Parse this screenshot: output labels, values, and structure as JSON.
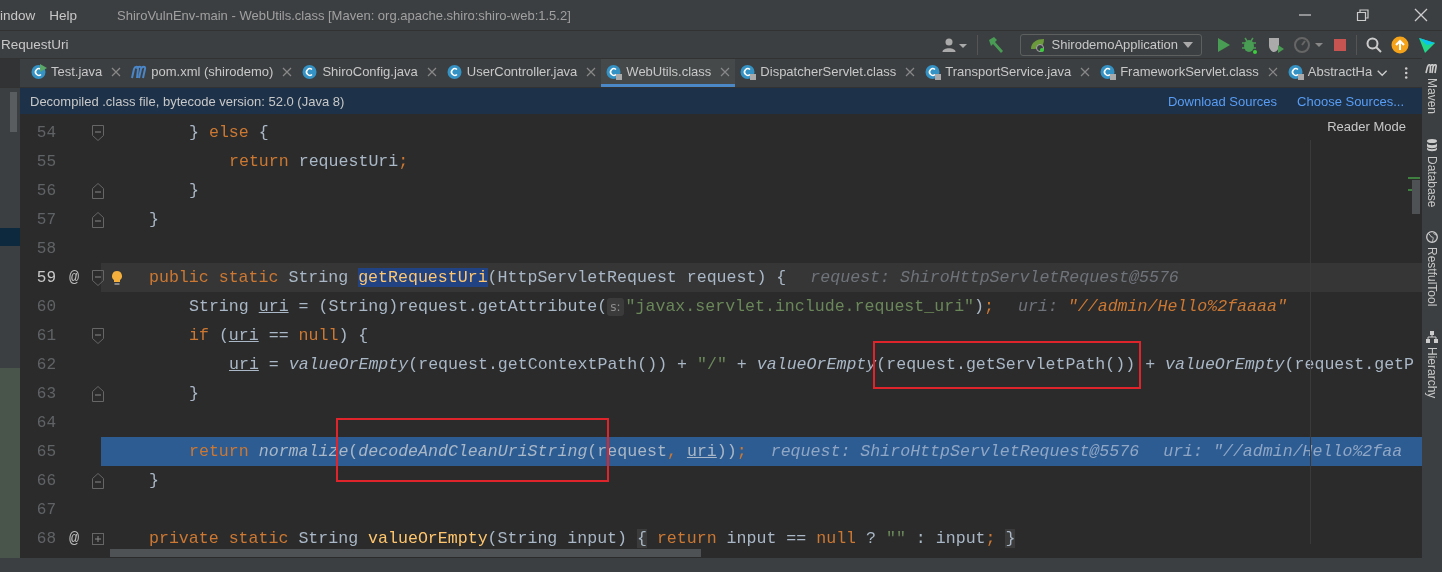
{
  "menu": [
    "indow",
    "Help"
  ],
  "window": {
    "title": "ShiroVulnEnv-main - WebUtils.class [Maven: org.apache.shiro:shiro-web:1.5.2]"
  },
  "breadcrumb": "RequestUri",
  "run_config": "ShirodemoApplication",
  "tabs": [
    {
      "label": "Test.java",
      "kind": "class-run",
      "selected": false,
      "closable": true
    },
    {
      "label": "pom.xml (shirodemo)",
      "kind": "maven",
      "selected": false,
      "closable": true
    },
    {
      "label": "ShiroConfig.java",
      "kind": "class",
      "selected": false,
      "closable": true
    },
    {
      "label": "UserController.java",
      "kind": "class",
      "selected": false,
      "closable": true
    },
    {
      "label": "WebUtils.class",
      "kind": "class-locked",
      "selected": true,
      "closable": true
    },
    {
      "label": "DispatcherServlet.class",
      "kind": "class-locked",
      "selected": false,
      "closable": true
    },
    {
      "label": "TransportService.java",
      "kind": "class-locked",
      "selected": false,
      "closable": true
    },
    {
      "label": "FrameworkServlet.class",
      "kind": "class-locked",
      "selected": false,
      "closable": true
    },
    {
      "label": "AbstractHa",
      "kind": "class-locked",
      "selected": false,
      "closable": false
    }
  ],
  "notice": {
    "text": "Decompiled .class file, bytecode version: 52.0 (Java 8)",
    "links": [
      "Download Sources",
      "Choose Sources..."
    ]
  },
  "reader_mode": "Reader Mode",
  "lines": [
    {
      "children": [
        {
          "number": "54",
          "current": false,
          "caret": false,
          "bulb": false,
          "fold_start": true,
          "fold_end": false,
          "collapsed": false,
          "tokens": [
            {
              "text": "} ",
              "kind": "plain"
            },
            {
              "text": "else",
              "kind": "kw"
            },
            {
              "text": " {",
              "kind": "plain"
            }
          ],
          "children": [
            {
              "number": "55",
              "current": false,
              "caret": false,
              "bulb": false,
              "fold_start": false,
              "fold_end": false,
              "collapsed": false,
              "tokens": [
                {
                  "text": "return",
                  "kind": "kw"
                },
                {
                  "text": " requestUri",
                  "kind": "plain"
                },
                {
                  "text": ";",
                  "kind": "kw"
                }
              ]
            }
          ]
        },
        {
          "number": "56",
          "current": false,
          "caret": false,
          "bulb": false,
          "fold_start": false,
          "fold_end": true,
          "collapsed": false,
          "tokens": [
            {
              "text": "}",
              "kind": "plain"
            }
          ]
        }
      ]
    },
    {
      "number": "57",
      "current": false,
      "caret": false,
      "bulb": false,
      "fold_start": false,
      "fold_end": true,
      "collapsed": false,
      "tokens": [
        {
          "text": "}",
          "kind": "plain"
        }
      ]
    },
    {
      "number": "58",
      "current": false,
      "caret": false,
      "bulb": false,
      "fold_start": false,
      "fold_end": false,
      "collapsed": false
    },
    {
      "number": "59",
      "mark": "@",
      "current": false,
      "caret": true,
      "bulb": true,
      "fold_start": true,
      "fold_end": false,
      "collapsed": false,
      "tokens": [
        {
          "text": "public static ",
          "kind": "kw"
        },
        {
          "text": "String ",
          "kind": "plain"
        },
        {
          "text": "getRequestUri",
          "kind": "decl-selected"
        },
        {
          "text": "(HttpServletRequest request) {",
          "kind": "plain"
        }
      ],
      "hints": [
        {
          "label": "request:",
          "value": "ShiroHttpServletRequest@5576",
          "kind": "object"
        }
      ],
      "children": [
        {
          "number": "60",
          "current": false,
          "caret": false,
          "bulb": false,
          "fold_start": false,
          "fold_end": false,
          "collapsed": false,
          "tokens": [
            {
              "text": "String ",
              "kind": "plain"
            },
            {
              "text": "uri",
              "kind": "var"
            },
            {
              "text": " = (String)request.getAttribute(",
              "kind": "plain"
            },
            {
              "text": "s:",
              "kind": "param-hint"
            },
            {
              "text": "\"javax.servlet.include.request_uri\"",
              "kind": "str"
            },
            {
              "text": ")",
              "kind": "plain"
            },
            {
              "text": ";",
              "kind": "kw"
            }
          ],
          "hints": [
            {
              "label": "uri:",
              "value": "\"//admin/Hello%2faaaa\"",
              "kind": "string"
            }
          ]
        },
        {
          "number": "61",
          "current": false,
          "caret": false,
          "bulb": false,
          "fold_start": true,
          "fold_end": false,
          "collapsed": false,
          "tokens": [
            {
              "text": "if",
              "kind": "kw"
            },
            {
              "text": " (",
              "kind": "plain"
            },
            {
              "text": "uri",
              "kind": "var"
            },
            {
              "text": " == ",
              "kind": "plain"
            },
            {
              "text": "null",
              "kind": "kw"
            },
            {
              "text": ") {",
              "kind": "plain"
            }
          ],
          "children": [
            {
              "number": "62",
              "current": false,
              "caret": false,
              "bulb": false,
              "fold_start": false,
              "fold_end": false,
              "collapsed": false,
              "tokens": [
                {
                  "text": "uri",
                  "kind": "var"
                },
                {
                  "text": " = ",
                  "kind": "plain"
                },
                {
                  "text": "valueOrEmpty",
                  "kind": "static"
                },
                {
                  "text": "(request.getContextPath()) + ",
                  "kind": "plain"
                },
                {
                  "text": "\"/\"",
                  "kind": "str"
                },
                {
                  "text": " + ",
                  "kind": "plain"
                },
                {
                  "text": "valueOrEmpty",
                  "kind": "static"
                },
                {
                  "text": "(request.getServletPath())",
                  "kind": "plain"
                },
                {
                  "text": " + ",
                  "kind": "plain"
                },
                {
                  "text": "valueOrEmpty",
                  "kind": "static"
                },
                {
                  "text": "(request.getP",
                  "kind": "plain"
                }
              ]
            }
          ]
        },
        {
          "number": "63",
          "current": false,
          "caret": false,
          "bulb": false,
          "fold_start": false,
          "fold_end": true,
          "collapsed": false,
          "tokens": [
            {
              "text": "}",
              "kind": "plain"
            }
          ]
        },
        {
          "number": "64",
          "current": false,
          "caret": false,
          "bulb": false,
          "fold_start": false,
          "fold_end": false,
          "collapsed": false
        },
        {
          "number": "65",
          "current": true,
          "caret": false,
          "bulb": false,
          "fold_start": false,
          "fold_end": false,
          "collapsed": false,
          "tokens": [
            {
              "text": "return ",
              "kind": "kw"
            },
            {
              "text": "normalize",
              "kind": "static"
            },
            {
              "text": "(",
              "kind": "plain"
            },
            {
              "text": "decodeAndCleanUriString",
              "kind": "static"
            },
            {
              "text": "(request",
              "kind": "plain"
            },
            {
              "text": ", ",
              "kind": "kw"
            },
            {
              "text": "uri",
              "kind": "var"
            },
            {
              "text": "))",
              "kind": "plain"
            },
            {
              "text": ";",
              "kind": "kw"
            }
          ],
          "hints": [
            {
              "label": "request:",
              "value": "ShiroHttpServletRequest@5576",
              "kind": "object"
            },
            {
              "label": "uri:",
              "value": "\"//admin/Hello%2faa",
              "kind": "object"
            }
          ]
        }
      ]
    },
    {
      "number": "66",
      "current": false,
      "caret": false,
      "bulb": false,
      "fold_start": false,
      "fold_end": true,
      "collapsed": false,
      "tokens": [
        {
          "text": "}",
          "kind": "plain"
        }
      ]
    },
    {
      "number": "67",
      "current": false,
      "caret": false,
      "bulb": false,
      "fold_start": false,
      "fold_end": false,
      "collapsed": false
    },
    {
      "number": "68",
      "mark": "@",
      "current": false,
      "caret": false,
      "bulb": false,
      "fold_start": false,
      "fold_end": false,
      "collapsed": true,
      "tokens": [
        {
          "text": "private static ",
          "kind": "kw"
        },
        {
          "text": "String ",
          "kind": "plain"
        },
        {
          "text": "valueOrEmpty",
          "kind": "decl"
        },
        {
          "text": "(String input) ",
          "kind": "plain"
        },
        {
          "text": "{",
          "kind": "folded"
        },
        {
          "text": " return",
          "kind": "kw"
        },
        {
          "text": " input == ",
          "kind": "plain"
        },
        {
          "text": "null",
          "kind": "kw"
        },
        {
          "text": " ? ",
          "kind": "plain"
        },
        {
          "text": "\"\"",
          "kind": "str"
        },
        {
          "text": " : input",
          "kind": "plain"
        },
        {
          "text": "; ",
          "kind": "kw"
        },
        {
          "text": "}",
          "kind": "folded"
        }
      ]
    }
  ],
  "side_tools": [
    "Maven",
    "Database",
    "RestfulTool",
    "Hierarchy"
  ]
}
